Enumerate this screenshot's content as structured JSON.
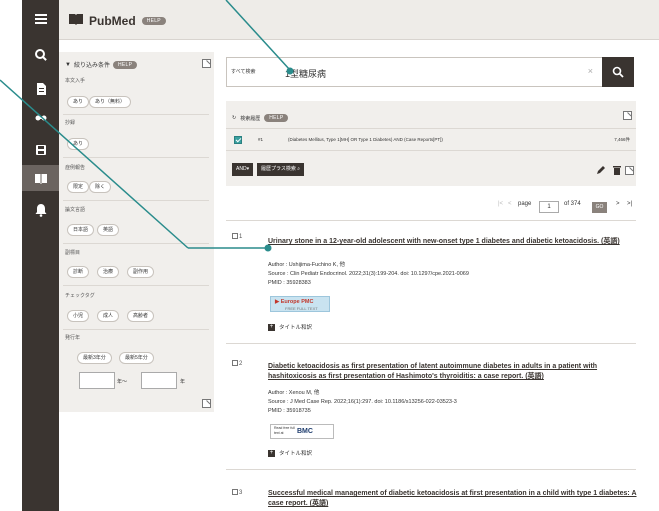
{
  "app": {
    "title": "PubMed",
    "help_label": "HELP"
  },
  "rail": {
    "icons": [
      "menu-icon",
      "search-icon",
      "document-icon",
      "link-icon",
      "save-icon",
      "book-icon",
      "bell-icon"
    ]
  },
  "filters": {
    "header": "絞り込み条件",
    "help_label": "HELP",
    "sections": [
      {
        "label": "本文入手",
        "chips": [
          "あり",
          "あり（無料）"
        ]
      },
      {
        "label": "抄録",
        "chips": [
          "あり"
        ]
      },
      {
        "label": "症例報告",
        "chips": [
          "限定",
          "除く"
        ]
      },
      {
        "label": "論文言語",
        "chips": [
          "日本語",
          "英語"
        ]
      },
      {
        "label": "副標目",
        "chips": [
          "診断",
          "治療",
          "副作用"
        ]
      },
      {
        "label": "チェックタグ",
        "chips": [
          "小児",
          "成人",
          "高齢者"
        ]
      },
      {
        "label": "発行年",
        "chips": [
          "最新3年分",
          "最新5年分"
        ]
      }
    ],
    "year_from_suffix": "年～",
    "year_to_suffix": "年"
  },
  "search": {
    "field_label": "すべて検索",
    "query": "1型糖尿病",
    "clear_label": "×"
  },
  "history": {
    "title": "検索履歴",
    "help_label": "HELP",
    "rows": [
      {
        "num": "#1",
        "query": "(Diabetes Mellitus, Type 1[MH] OR Type 1 Diabetes) AND (Case Reports[PT])",
        "count": "7,466件"
      }
    ],
    "and_label": "AND",
    "re_search_label": "履歴プラス検索"
  },
  "pagination": {
    "first": "|<",
    "prev": "<",
    "page_label": "page",
    "page_value": "1",
    "of_label": "of 374",
    "go_label": "GO",
    "next": ">",
    "last": ">|"
  },
  "results": [
    {
      "num": "1",
      "title": "Urinary stone in a 12-year-old adolescent with new-onset type 1 diabetes and diabetic ketoacidosis. (英語)",
      "author": "Author : Ushijima-Fuchino K, 他",
      "source": "Source : Clin Pediatr Endocrinol. 2022;31(3):199-204. doi: 10.1297/cpe.2021-0069",
      "pmid": "PMID : 35928383",
      "badge": {
        "type": "europepmc",
        "line1": "Europe PMC",
        "line2": "FREE FULL TEXT"
      },
      "translate": "タイトル和訳"
    },
    {
      "num": "2",
      "title": "Diabetic ketoacidosis as first presentation of latent autoimmune diabetes in adults in a patient with hashitoxicosis as first presentation of Hashimoto's thyroiditis: a case report. (英語)",
      "author": "Author : Xenou M, 他",
      "source": "Source : J Med Case Rep. 2022;16(1):297. doi: 10.1186/s13256-022-03523-3",
      "pmid": "PMID : 35918735",
      "badge": {
        "type": "bmc",
        "line1": "Read free full text at",
        "line2": "BMC"
      },
      "translate": "タイトル和訳"
    },
    {
      "num": "3",
      "title": "Successful medical management of diabetic ketoacidosis at first presentation in a child with type 1 diabetes: A case report. (英語)"
    }
  ],
  "colors": {
    "rail": "#3a3430",
    "panel": "#f1efec",
    "accent_teal": "#2a8c8c"
  }
}
